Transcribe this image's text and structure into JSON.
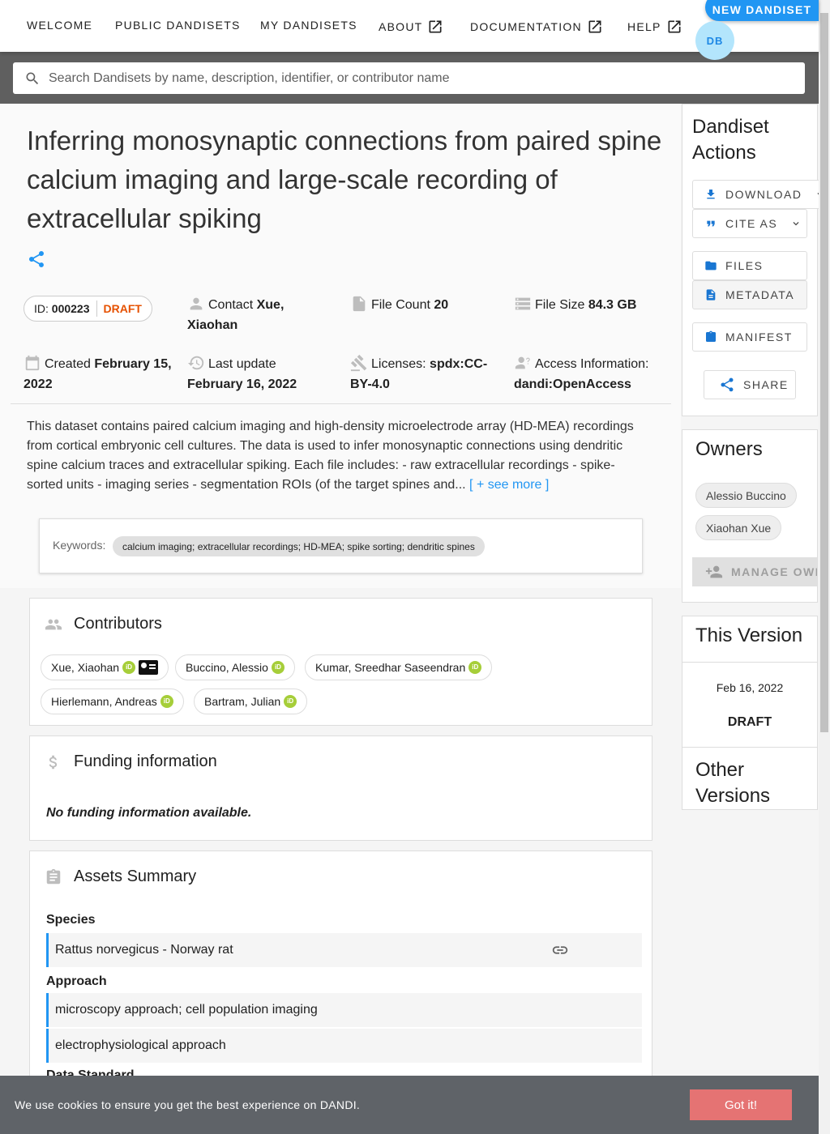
{
  "nav": {
    "welcome": "WELCOME",
    "public_dandisets": "PUBLIC DANDISETS",
    "my_dandisets": "MY DANDISETS",
    "about": "ABOUT",
    "documentation": "DOCUMENTATION",
    "help": "HELP",
    "new_dandiset": "NEW DANDISET",
    "avatar_initials": "DB"
  },
  "search": {
    "placeholder": "Search Dandisets by name, description, identifier, or contributor name"
  },
  "dandiset": {
    "title": "Inferring monosynaptic connections from paired spine calcium imaging and large-scale recording of extracellular spiking",
    "id_label": "ID:",
    "id_value": "000223",
    "status": "DRAFT",
    "contact_label": "Contact",
    "contact_value_1": "Xue,",
    "contact_value_2": "Xiaohan",
    "file_count_label": "File Count",
    "file_count_value": "20",
    "file_size_label": "File Size",
    "file_size_value": "84.3 GB",
    "created_label": "Created",
    "created_value_1": "February 15,",
    "created_value_2": "2022",
    "updated_label": "Last update",
    "updated_value": "February 16, 2022",
    "licenses_label": "Licenses:",
    "licenses_value_1": "spdx:CC-",
    "licenses_value_2": "BY-4.0",
    "access_label": "Access Information:",
    "access_value": "dandi:OpenAccess",
    "description": "This dataset contains paired calcium imaging and high-density microelectrode array (HD-MEA) recordings from cortical embryonic cell cultures. The data is used to infer monosynaptic connections using dendritic spine calcium traces and extracellular spiking. Each file includes: - raw extracellular recordings - spike-sorted units - imaging series - segmentation ROIs (of the target spines and...",
    "see_more": "[ + see more ]",
    "keywords_label": "Keywords:",
    "keywords": "calcium imaging; extracellular recordings; HD-MEA; spike sorting; dendritic spines"
  },
  "contributors": {
    "heading": "Contributors",
    "items": [
      "Xue, Xiaohan",
      "Buccino, Alessio",
      "Kumar, Sreedhar Saseendran",
      "Hierlemann, Andreas",
      "Bartram, Julian"
    ],
    "orcid_badge": "iD"
  },
  "funding": {
    "heading": "Funding information",
    "empty_text": "No funding information available."
  },
  "assets": {
    "heading": "Assets Summary",
    "species_label": "Species",
    "species": [
      "Rattus norvegicus - Norway rat"
    ],
    "approach_label": "Approach",
    "approaches": [
      "microscopy approach; cell population imaging",
      "electrophysiological approach"
    ],
    "data_standard_label": "Data Standard"
  },
  "sidebar": {
    "actions_title_1": "Dandiset",
    "actions_title_2": "Actions",
    "download": "DOWNLOAD",
    "cite_as": "CITE AS",
    "files": "FILES",
    "metadata": "METADATA",
    "manifest": "MANIFEST",
    "share": "SHARE",
    "owners_title": "Owners",
    "owners": [
      "Alessio Buccino",
      "Xiaohan Xue"
    ],
    "manage_owners": "MANAGE OWNERS",
    "this_version_title": "This Version",
    "version_date": "Feb 16, 2022",
    "version_status": "DRAFT",
    "other_versions_1": "Other",
    "other_versions_2": "Versions"
  },
  "cookie": {
    "text": "We use cookies to ensure you get the best experience on DANDI.",
    "button": "Got it!"
  },
  "colors": {
    "accent": "#2196f3",
    "draft": "#e65100",
    "orcid": "#a6ce39",
    "cookie_button": "#e57373"
  }
}
